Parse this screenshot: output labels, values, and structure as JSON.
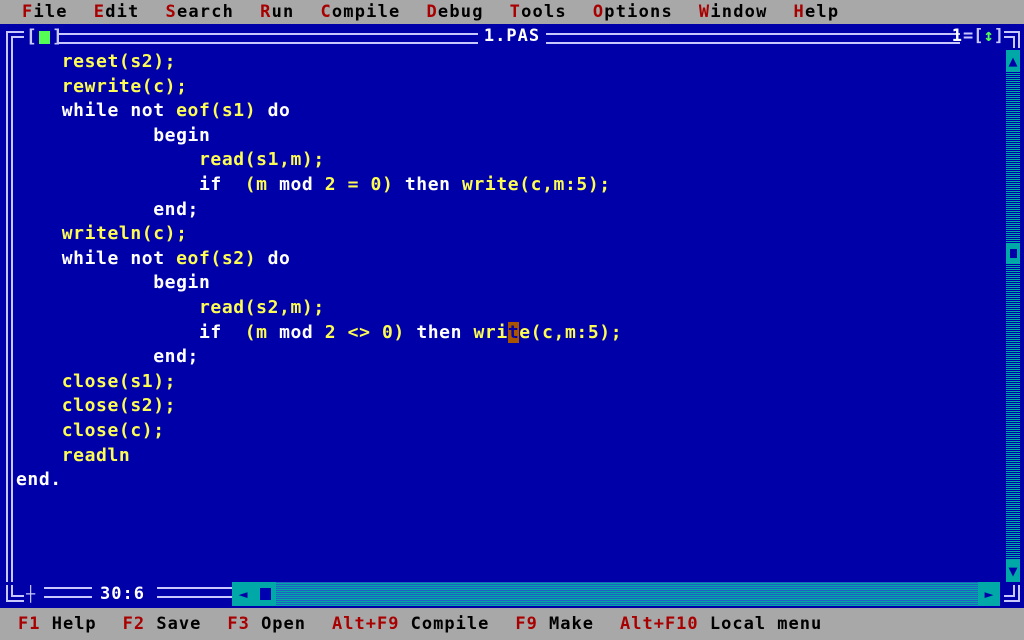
{
  "menubar": {
    "items": [
      {
        "hotkey": "F",
        "rest": "ile"
      },
      {
        "hotkey": "E",
        "rest": "dit"
      },
      {
        "hotkey": "S",
        "rest": "earch"
      },
      {
        "hotkey": "R",
        "rest": "un"
      },
      {
        "hotkey": "C",
        "rest": "ompile"
      },
      {
        "hotkey": "D",
        "rest": "ebug"
      },
      {
        "hotkey": "T",
        "rest": "ools"
      },
      {
        "hotkey": "O",
        "rest": "ptions"
      },
      {
        "hotkey": "W",
        "rest": "indow"
      },
      {
        "hotkey": "H",
        "rest": "elp"
      }
    ]
  },
  "window": {
    "title": "1.PAS",
    "number": "1",
    "close_box_left": "[",
    "close_box_right": "]",
    "resize_left": "=[",
    "resize_glyph": "↕",
    "resize_right": "]",
    "line_col": "30:6",
    "drag_glyph": "┼"
  },
  "editor": {
    "cursor_line": 12,
    "cursor_char_index": 29,
    "lines": [
      [
        {
          "t": "    ",
          "c": "id"
        },
        {
          "t": "reset(s2);",
          "c": "id"
        }
      ],
      [
        {
          "t": "    ",
          "c": "id"
        },
        {
          "t": "rewrite(c);",
          "c": "id"
        }
      ],
      [
        {
          "t": "    ",
          "c": "id"
        },
        {
          "t": "while",
          "c": "kw"
        },
        {
          "t": " ",
          "c": "id"
        },
        {
          "t": "not",
          "c": "kw"
        },
        {
          "t": " ",
          "c": "id"
        },
        {
          "t": "eof(s1)",
          "c": "id"
        },
        {
          "t": " ",
          "c": "id"
        },
        {
          "t": "do",
          "c": "kw"
        }
      ],
      [
        {
          "t": "            ",
          "c": "id"
        },
        {
          "t": "begin",
          "c": "kw"
        }
      ],
      [
        {
          "t": "                ",
          "c": "id"
        },
        {
          "t": "read(s1,m);",
          "c": "id"
        }
      ],
      [
        {
          "t": "                ",
          "c": "id"
        },
        {
          "t": "if",
          "c": "kw"
        },
        {
          "t": "  (m ",
          "c": "id"
        },
        {
          "t": "mod",
          "c": "kw"
        },
        {
          "t": " 2 = 0) ",
          "c": "id"
        },
        {
          "t": "then",
          "c": "kw"
        },
        {
          "t": " write(c,m:5);",
          "c": "id"
        }
      ],
      [
        {
          "t": "            ",
          "c": "id"
        },
        {
          "t": "end;",
          "c": "kw"
        }
      ],
      [
        {
          "t": "    ",
          "c": "id"
        },
        {
          "t": "writeln(c);",
          "c": "id"
        }
      ],
      [
        {
          "t": "    ",
          "c": "id"
        },
        {
          "t": "while",
          "c": "kw"
        },
        {
          "t": " ",
          "c": "id"
        },
        {
          "t": "not",
          "c": "kw"
        },
        {
          "t": " ",
          "c": "id"
        },
        {
          "t": "eof(s2)",
          "c": "id"
        },
        {
          "t": " ",
          "c": "id"
        },
        {
          "t": "do",
          "c": "kw"
        }
      ],
      [
        {
          "t": "            ",
          "c": "id"
        },
        {
          "t": "begin",
          "c": "kw"
        }
      ],
      [
        {
          "t": "                ",
          "c": "id"
        },
        {
          "t": "read(s2,m);",
          "c": "id"
        }
      ],
      [
        {
          "t": "                ",
          "c": "id"
        },
        {
          "t": "if",
          "c": "kw"
        },
        {
          "t": "  (m ",
          "c": "id"
        },
        {
          "t": "mod",
          "c": "kw"
        },
        {
          "t": " 2 <> 0) ",
          "c": "id"
        },
        {
          "t": "then",
          "c": "kw"
        },
        {
          "t": " wri",
          "c": "id"
        },
        {
          "t": "t",
          "c": "cursor"
        },
        {
          "t": "e(c,m:5);",
          "c": "id"
        }
      ],
      [
        {
          "t": "            ",
          "c": "id"
        },
        {
          "t": "end;",
          "c": "kw"
        }
      ],
      [
        {
          "t": "    ",
          "c": "id"
        },
        {
          "t": "close(s1);",
          "c": "id"
        }
      ],
      [
        {
          "t": "    ",
          "c": "id"
        },
        {
          "t": "close(s2);",
          "c": "id"
        }
      ],
      [
        {
          "t": "    ",
          "c": "id"
        },
        {
          "t": "close(c);",
          "c": "id"
        }
      ],
      [
        {
          "t": "    ",
          "c": "id"
        },
        {
          "t": "readln",
          "c": "id"
        }
      ],
      [
        {
          "t": "end.",
          "c": "kw"
        }
      ],
      [],
      [],
      []
    ]
  },
  "scrollbars": {
    "vertical": {
      "up_glyph": "▲",
      "down_glyph": "▼"
    },
    "horizontal": {
      "left_glyph": "◄",
      "right_glyph": "►"
    }
  },
  "statusbar": {
    "items": [
      {
        "key": "F1",
        "label": " Help"
      },
      {
        "key": "F2",
        "label": " Save"
      },
      {
        "key": "F3",
        "label": " Open"
      },
      {
        "key": "Alt+F9",
        "label": " Compile"
      },
      {
        "key": "F9",
        "label": " Make"
      },
      {
        "key": "Alt+F10",
        "label": " Local menu"
      }
    ]
  },
  "colors": {
    "desktop_blue": "#0000a8",
    "menu_gray": "#a8a8a8",
    "hotkey_red": "#a80000",
    "identifier_yellow": "#fcfc54",
    "keyword_white": "#ffffff",
    "frame_light": "#c8c8ff",
    "scroll_cyan": "#00a8a8",
    "cursor_orange": "#a85400",
    "close_green": "#54fc54"
  }
}
